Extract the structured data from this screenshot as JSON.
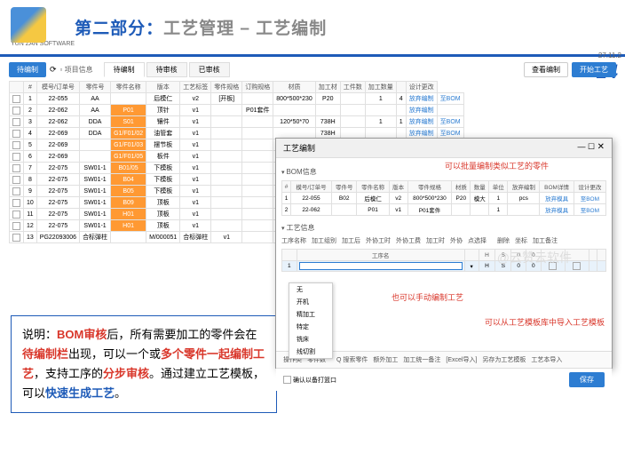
{
  "header": {
    "logo_sub": "YUN ZAN SOFTWARE",
    "title_part": "第二部分：",
    "title_main": "工艺管理 – 工艺编制",
    "date": "27.11.2",
    "pagenum": "14"
  },
  "toolbar": {
    "btn_pending": "待编制",
    "tab_pending": "待编制",
    "tab_review": "待审核",
    "tab_done": "已审核",
    "right_review_label": "查看编制",
    "right_detail": "开始工艺"
  },
  "main_table": {
    "headers": [
      "",
      "#",
      "模号/订单号",
      "零件号",
      "零件名称",
      "版本",
      "工艺标签",
      "零件规格",
      "订购规格",
      "材质",
      "加工材",
      "工件数",
      "加工数量",
      "",
      "设计更改"
    ],
    "rows": [
      [
        "1",
        "22-055",
        "AA",
        "",
        "后模仁",
        "v2",
        "[开板]",
        "",
        "800*500*230",
        "P20",
        "",
        "1",
        "4",
        "放弃编制",
        "至BOM"
      ],
      [
        "2",
        "22-062",
        "AA",
        "P01",
        "顶针",
        "v1",
        "",
        "P01套件",
        "",
        "",
        "",
        "",
        "",
        "放弃编制",
        ""
      ],
      [
        "3",
        "22-062",
        "DDA",
        "S01",
        "镶件",
        "v1",
        "",
        "",
        "120*50*70",
        "738H",
        "",
        "1",
        "1",
        "放弃编制",
        "至BOM"
      ],
      [
        "4",
        "22-069",
        "DDA",
        "G1/F01/02",
        "油管套",
        "v1",
        "",
        "",
        "",
        "738H",
        "",
        "",
        "",
        "放弃编制",
        "至BOM"
      ],
      [
        "5",
        "22-069",
        "",
        "G1/F01/03",
        "摆节板",
        "v1",
        "",
        "",
        "",
        "",
        "",
        "",
        "",
        "",
        " "
      ],
      [
        "6",
        "22-069",
        "",
        "G1/F01/05",
        "板件",
        "v1",
        "",
        "",
        "",
        "",
        "",
        "",
        "",
        "",
        " "
      ],
      [
        "7",
        "22-075",
        "SW01-1",
        "B01/05",
        "下模板",
        "v1",
        "",
        "",
        "",
        "",
        "",
        "",
        "",
        "",
        " "
      ],
      [
        "8",
        "22-075",
        "SW01-1",
        "B04",
        "下模板",
        "v1",
        "",
        "",
        "",
        "",
        "",
        "",
        "",
        "",
        " "
      ],
      [
        "9",
        "22-075",
        "SW01-1",
        "B05",
        "下模板",
        "v1",
        "",
        "",
        "",
        "",
        "",
        "",
        "",
        "",
        " "
      ],
      [
        "10",
        "22-075",
        "SW01-1",
        "B09",
        "顶板",
        "v1",
        "",
        "",
        "",
        "",
        "",
        "",
        "",
        "",
        " "
      ],
      [
        "11",
        "22-075",
        "SW01-1",
        "H01",
        "顶板",
        "v1",
        "",
        "",
        "",
        "",
        "",
        "",
        "",
        "",
        " "
      ],
      [
        "12",
        "22-075",
        "SW01-1",
        "H01",
        "顶板",
        "v1",
        "",
        "",
        "",
        "",
        "",
        "",
        "",
        "",
        " "
      ],
      [
        "13",
        "PG22093006",
        "合标弹柱",
        "",
        "M/000051",
        "合标弹柱",
        "v1",
        "",
        "",
        "",
        "",
        "",
        "",
        "",
        " "
      ]
    ]
  },
  "popup": {
    "title": "工艺编制",
    "section_bom": "BOM信息",
    "ann_batch": "可以批量编制类似工艺的零件",
    "bom_headers": [
      "#",
      "模号/订单号",
      "零件号",
      "零件名称",
      "版本",
      "零件规格",
      "材质",
      "数量",
      "单位",
      "放弃编制",
      "BOM详情",
      "设计更改"
    ],
    "bom_rows": [
      [
        "1",
        "22-055",
        "B02",
        "后模仁",
        "v2",
        "800*500*230",
        "P20",
        "模大",
        "1",
        "pcs",
        "放弃模具",
        "至BOM"
      ],
      [
        "2",
        "22-062",
        "",
        "P01",
        "v1",
        "P01套件",
        "",
        "",
        "1",
        "",
        "放弃模具",
        "至BOM"
      ]
    ],
    "section_ws": "工艺信息",
    "ws_tabs": [
      "工序名称",
      "加工组别",
      "加工后",
      "外协工时",
      "外协工费",
      "加工时",
      "外协",
      "点选择",
      "",
      "删除",
      "坐标",
      "加工备注"
    ],
    "ws_grid_headers": [
      "",
      "工序名",
      "",
      "H",
      "S",
      "0",
      "0",
      "",
      "",
      "",
      ""
    ],
    "input_placeholder": "",
    "dropdown_items": [
      "无",
      "开机",
      "精加工",
      "特定",
      "铣床",
      "线切割"
    ],
    "ann_manual": "也可以手动编制工艺",
    "ann_template": "可以从工艺模板库中导入工艺模板",
    "footer_items": [
      "操作类",
      "零件数",
      "",
      "Q 搜索零件",
      "额外加工",
      "加工统一备注",
      "[Excel导入]",
      "另存为工艺模板",
      "工艺本导入"
    ],
    "confirm_checkbox": "确认以备打篮口",
    "save": "保存"
  },
  "explain": {
    "prefix": "说明：",
    "p1a": "BOM审核",
    "p1b": "后，所有需要加工的零件会在",
    "p1c": "待编制栏",
    "p1d": "出现，可以一个或",
    "p1e": "多个零件一起编制工艺",
    "p1f": "，支持工序的",
    "p1g": "分步审核",
    "p1h": "。通过建立工艺模板，可以",
    "p1i": "快速生成工艺",
    "p1j": "。"
  },
  "watermark": "@云赞云软件"
}
